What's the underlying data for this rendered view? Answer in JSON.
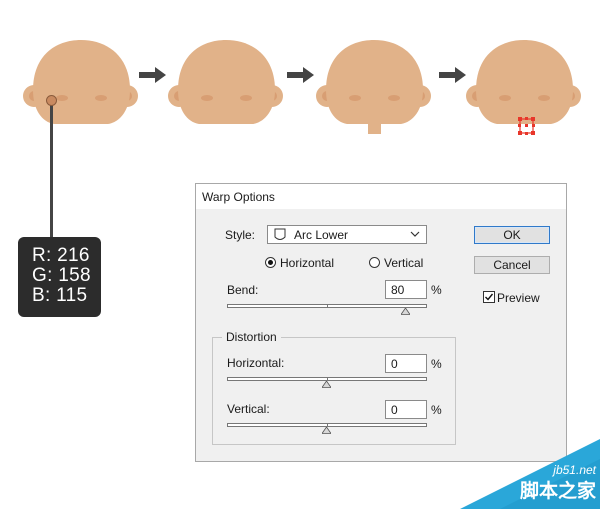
{
  "color_readout": {
    "r_label": "R: 216",
    "g_label": "G: 158",
    "b_label": "B: 115",
    "swatch_color": "#d89e73"
  },
  "dialog": {
    "title": "Warp Options",
    "style_label": "Style:",
    "style_value": "Arc Lower",
    "horizontal_label": "Horizontal",
    "vertical_label": "Vertical",
    "orientation_selected": "Horizontal",
    "bend_label": "Bend:",
    "bend_value": "80",
    "bend_level": 80,
    "percent": "%",
    "distortion_title": "Distortion",
    "dist_horizontal_label": "Horizontal:",
    "dist_horizontal_value": "0",
    "dist_horizontal_level": 0,
    "dist_vertical_label": "Vertical:",
    "dist_vertical_value": "0",
    "dist_vertical_level": 0,
    "ok_label": "OK",
    "cancel_label": "Cancel",
    "preview_label": "Preview",
    "preview_checked": true
  },
  "watermark": {
    "line1": "jb51.net",
    "line2": "脚本之家"
  },
  "colors": {
    "skin": "#e1b289",
    "cheek": "#d89e73",
    "arrow": "#444444",
    "selection": "#e8362a",
    "watermark": "#2aa7d9"
  },
  "icons": {
    "arrow": "right-arrow-icon",
    "chevron": "chevron-down-icon",
    "style": "arc-lower-style-icon",
    "slider_thumb": "triangle-up-icon"
  }
}
